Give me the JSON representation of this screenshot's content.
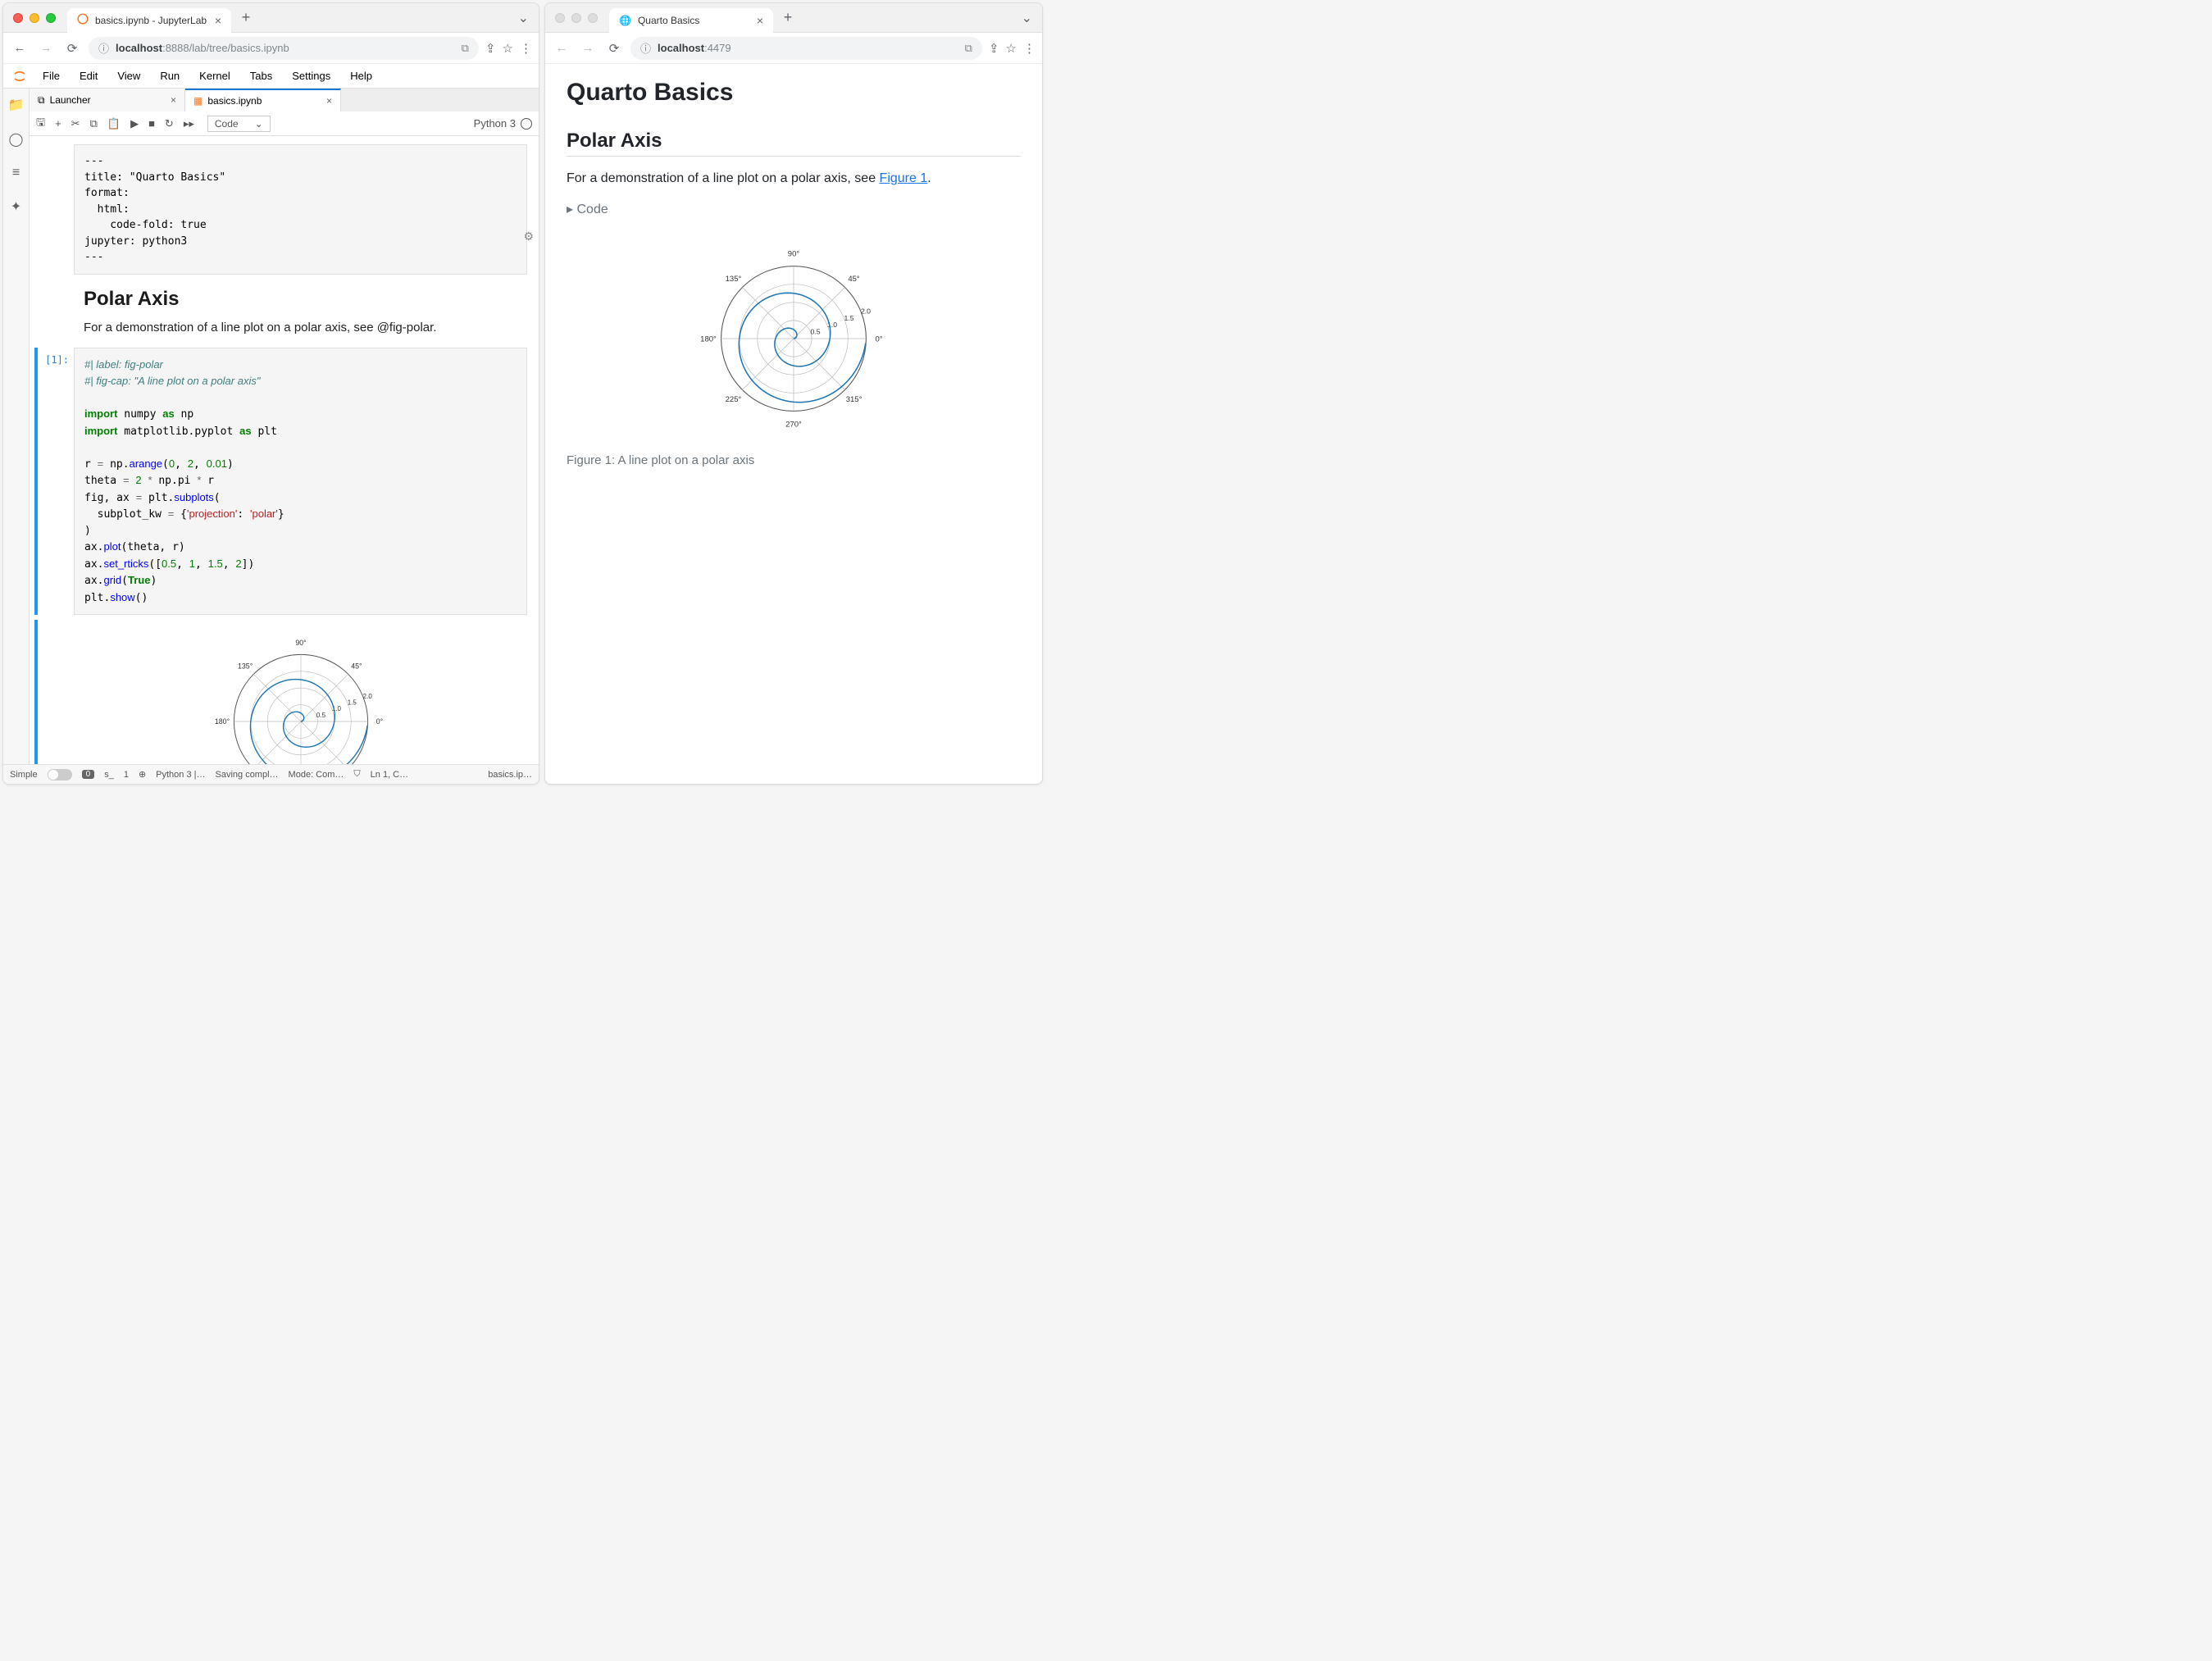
{
  "left_browser": {
    "tab_title": "basics.ipynb - JupyterLab",
    "url_host": "localhost",
    "url_port_path": ":8888/lab/tree/basics.ipynb"
  },
  "right_browser": {
    "tab_title": "Quarto Basics",
    "url_host": "localhost",
    "url_port": ":4479"
  },
  "jupyter": {
    "menu": [
      "File",
      "Edit",
      "View",
      "Run",
      "Kernel",
      "Tabs",
      "Settings",
      "Help"
    ],
    "tabs": {
      "launcher": "Launcher",
      "notebook": "basics.ipynb"
    },
    "cell_type": "Code",
    "kernel": "Python 3",
    "prompt_1": "[1]:",
    "status": {
      "simple": "Simple",
      "zero": "0",
      "s": "s_",
      "one": "1",
      "kern": "Python 3 |…",
      "save": "Saving compl…",
      "mode": "Mode: Com…",
      "ln": "Ln 1, C…",
      "file": "basics.ip…"
    }
  },
  "raw_cell": "---\ntitle: \"Quarto Basics\"\nformat:\n  html:\n    code-fold: true\njupyter: python3\n---",
  "md_heading": "Polar Axis",
  "md_text": "For a demonstration of a line plot on a polar axis, see @fig-polar.",
  "quarto": {
    "title": "Quarto Basics",
    "h2": "Polar Axis",
    "p_pre": "For a demonstration of a line plot on a polar axis, see ",
    "p_link": "Figure 1",
    "p_post": ".",
    "code_toggle": "Code",
    "caption": "Figure 1: A line plot on a polar axis"
  },
  "chart_data": {
    "type": "line",
    "projection": "polar",
    "title": "",
    "theta_ticks_deg": [
      0,
      45,
      90,
      135,
      180,
      225,
      270,
      315
    ],
    "theta_tick_labels": [
      "0°",
      "45°",
      "90°",
      "135°",
      "180°",
      "225°",
      "270°",
      "315°"
    ],
    "r_ticks": [
      0.5,
      1.0,
      1.5,
      2.0
    ],
    "r_range": [
      0,
      2
    ],
    "series": [
      {
        "name": "spiral",
        "r_values": "r from 0 to 2 step 0.01",
        "theta_values": "theta = 2*pi*r",
        "color": "#1f77b4"
      }
    ],
    "grid": true
  }
}
